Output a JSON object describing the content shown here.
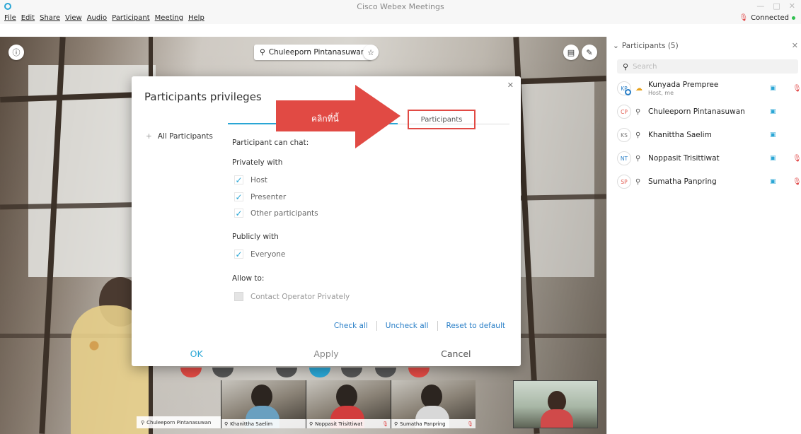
{
  "window": {
    "title": "Cisco Webex Meetings"
  },
  "menu": [
    "File",
    "Edit",
    "Share",
    "View",
    "Audio",
    "Participant",
    "Meeting",
    "Help"
  ],
  "connection": {
    "status": "Connected"
  },
  "stage": {
    "active_speaker": "Chuleeporn Pintanasuwan"
  },
  "dialog": {
    "title": "Participants privileges",
    "left_tab": "All Participants",
    "tab_participants": "Participants",
    "annotation": "คลิกที่นี้",
    "chat_section": "Participant can chat:",
    "privately_label": "Privately with",
    "privately_options": [
      {
        "label": "Host",
        "checked": true
      },
      {
        "label": "Presenter",
        "checked": true
      },
      {
        "label": "Other participants",
        "checked": true
      }
    ],
    "publicly_label": "Publicly with",
    "publicly_options": [
      {
        "label": "Everyone",
        "checked": true
      }
    ],
    "allow_label": "Allow to:",
    "allow_options": [
      {
        "label": "Contact Operator Privately",
        "checked": false,
        "disabled": true
      }
    ],
    "links": {
      "check_all": "Check all",
      "uncheck_all": "Uncheck all",
      "reset": "Reset to default"
    },
    "buttons": {
      "ok": "OK",
      "apply": "Apply",
      "cancel": "Cancel"
    }
  },
  "thumbnails": [
    {
      "name": "Chuleeporn Pintanasuwan",
      "muted": false
    },
    {
      "name": "Khanittha Saelim",
      "muted": false
    },
    {
      "name": "Noppasit Trisittiwat",
      "muted": true
    },
    {
      "name": "Sumatha Panpring",
      "muted": true
    }
  ],
  "panel": {
    "header": "Participants (5)",
    "search_placeholder": "Search",
    "participants": [
      {
        "initials": "KP",
        "name": "Kunyada Prempree",
        "role": "Host, me",
        "color": "#2a7fc7",
        "muted": true
      },
      {
        "initials": "CP",
        "name": "Chuleeporn Pintanasuwan",
        "role": "",
        "color": "#e15a4f",
        "muted": false
      },
      {
        "initials": "KS",
        "name": "Khanittha Saelim",
        "role": "",
        "color": "#777777",
        "muted": false
      },
      {
        "initials": "NT",
        "name": "Noppasit Trisittiwat",
        "role": "",
        "color": "#2a7fc7",
        "muted": true
      },
      {
        "initials": "SP",
        "name": "Sumatha Panpring",
        "role": "",
        "color": "#e15a4f",
        "muted": true
      }
    ]
  },
  "colors": {
    "accent": "#2aa6d5",
    "annotation_red": "#e14a44",
    "muted_red": "#e04848"
  }
}
